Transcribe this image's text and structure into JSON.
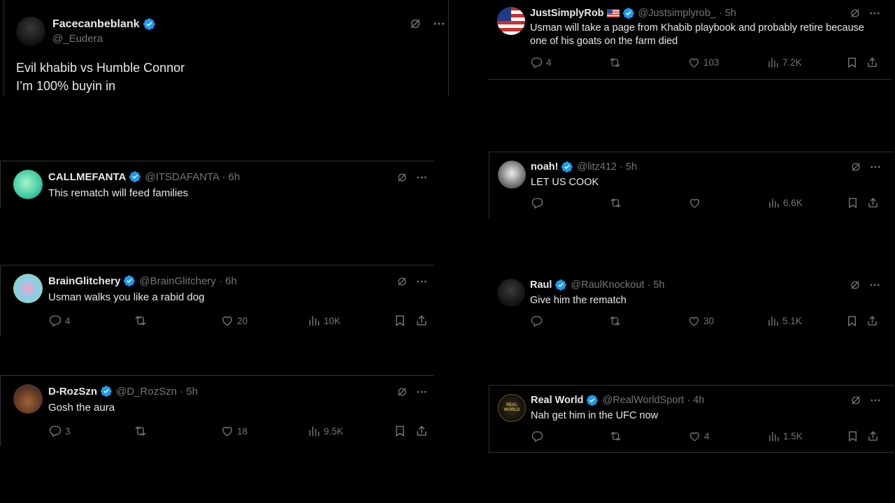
{
  "tweets": [
    {
      "name": "Facecanbeblank",
      "handle": "@_Eudera",
      "time": "",
      "lines": [
        "Evil khabib vs Humble Connor",
        "I’m 100% buyin in"
      ],
      "replies": "",
      "likes": "",
      "views": "",
      "has_actions": false
    },
    {
      "name": "CALLMEFANTA",
      "handle": "@ITSDAFANTA · 6h",
      "lines": [
        "This rematch will feed families"
      ],
      "has_actions": false
    },
    {
      "name": "BrainGlitchery",
      "handle": "@BrainGlitchery · 6h",
      "lines": [
        "Usman walks you like a rabid dog"
      ],
      "replies": "4",
      "likes": "20",
      "views": "10K",
      "has_actions": true
    },
    {
      "name": "D-RozSzn",
      "handle": "@D_RozSzn · 5h",
      "lines": [
        "Gosh the aura"
      ],
      "replies": "3",
      "likes": "18",
      "views": "9.5K",
      "has_actions": true
    },
    {
      "name": "JustSimplyRob",
      "handle": "@Justsimplyrob_ · 5h",
      "flag": "us-flag",
      "lines": [
        "Usman will take a page from Khabib playbook and probably retire because",
        "one of his goats on the farm died"
      ],
      "replies": "4",
      "likes": "103",
      "views": "7.2K",
      "has_actions": true
    },
    {
      "name": "noah!",
      "handle": "@litz412 · 5h",
      "lines": [
        "LET US COOK"
      ],
      "replies": "",
      "likes": "",
      "views": "6.6K",
      "has_actions": true
    },
    {
      "name": "Raul",
      "handle": "@RaulKnockout · 5h",
      "lines": [
        "Give him the rematch"
      ],
      "replies": "",
      "likes": "30",
      "views": "5.1K",
      "has_actions": true
    },
    {
      "name": "Real World",
      "handle": "@RealWorldSport · 4h",
      "avatar_text": "REAL WORLD",
      "lines": [
        "Nah get him in the UFC now"
      ],
      "replies": "",
      "likes": "4",
      "views": "1.5K",
      "has_actions": true
    }
  ],
  "colors": {
    "verified": "#1d9bf0",
    "muted": "#71767b",
    "text": "#e7e9ea",
    "border": "#2f3336"
  },
  "icons": [
    "verified-badge-icon",
    "grok-icon",
    "more-icon",
    "reply-icon",
    "retweet-icon",
    "like-icon",
    "views-icon",
    "bookmark-icon",
    "share-icon"
  ]
}
